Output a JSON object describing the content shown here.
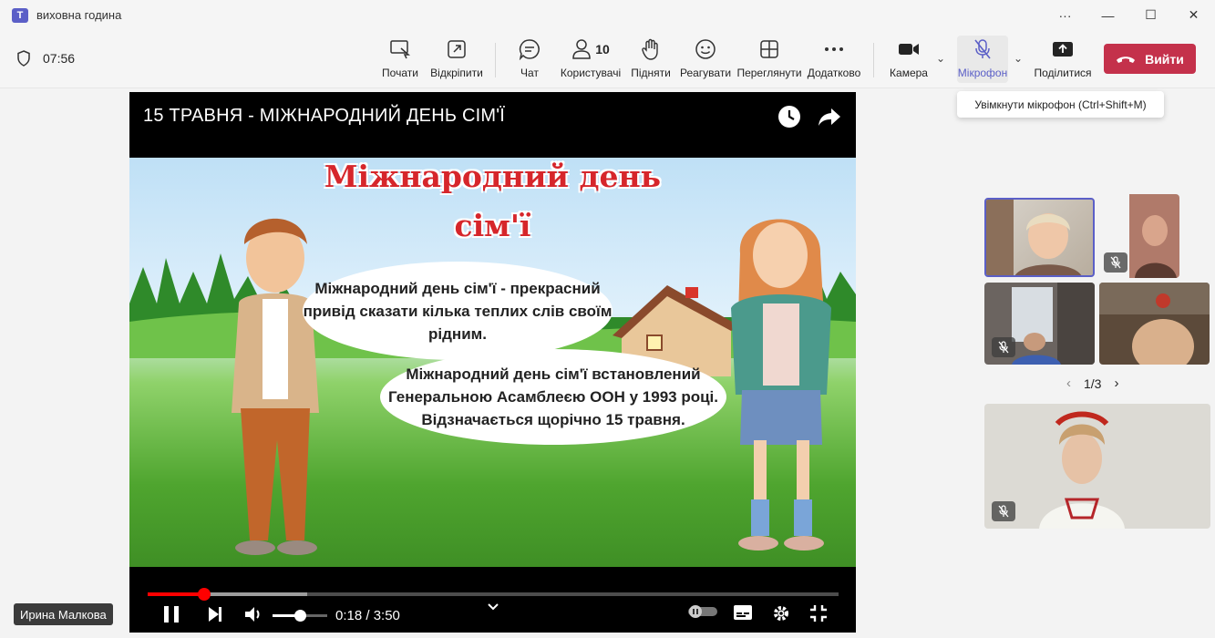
{
  "window": {
    "title": "виховна година",
    "app_icon": "teams-icon"
  },
  "toolbar": {
    "timer": "07:56",
    "tools": {
      "start": "Почати",
      "detach": "Відкріпити",
      "chat": "Чат",
      "people": "Користувачі",
      "people_count": "10",
      "raise": "Підняти",
      "react": "Реагувати",
      "view": "Переглянути",
      "more": "Додатково",
      "camera": "Камера",
      "mic": "Мікрофон",
      "share": "Поділитися"
    },
    "leave": "Вийти",
    "tooltip": "Увімкнути мікрофон (Ctrl+Shift+M)",
    "accent": "#5b5fc7",
    "leave_color": "#c4314b"
  },
  "video": {
    "title": "15 ТРАВНЯ - МІЖНАРОДНИЙ ДЕНЬ СІМ'Ї",
    "slide_title_1": "Міжнародний день",
    "slide_title_2": "сім'ї",
    "bubble1": "Міжнародний день сім'ї - прекрасний привід сказати кілька теплих слів своїм рідним.",
    "bubble2": "Міжнародний день сім'ї встановлений Генеральною Асамблеєю ООН у 1993 році. Відзначається щорічно 15 травня.",
    "time": "0:18 / 3:50",
    "progress": 0.078,
    "volume": 0.5
  },
  "participants": {
    "pager": "1/3"
  },
  "name_tag": "Ирина Малкова"
}
